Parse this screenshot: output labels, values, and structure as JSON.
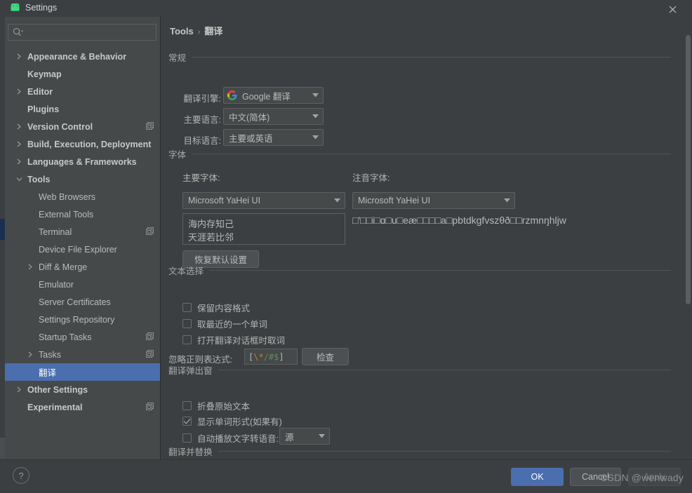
{
  "window": {
    "title": "Settings",
    "app_icon": "android-robot-icon",
    "close_icon": "close-icon"
  },
  "sidebar": {
    "search": {
      "placeholder": "",
      "value": "",
      "icon": "search-icon"
    },
    "items": [
      {
        "label": "Appearance & Behavior",
        "arrow": "chevron-right",
        "indent": 0,
        "bold": true,
        "selected": false,
        "copy": false
      },
      {
        "label": "Keymap",
        "arrow": "none",
        "indent": 0,
        "bold": true,
        "selected": false,
        "copy": false
      },
      {
        "label": "Editor",
        "arrow": "chevron-right",
        "indent": 0,
        "bold": true,
        "selected": false,
        "copy": false
      },
      {
        "label": "Plugins",
        "arrow": "none",
        "indent": 0,
        "bold": true,
        "selected": false,
        "copy": false
      },
      {
        "label": "Version Control",
        "arrow": "chevron-right",
        "indent": 0,
        "bold": true,
        "selected": false,
        "copy": true
      },
      {
        "label": "Build, Execution, Deployment",
        "arrow": "chevron-right",
        "indent": 0,
        "bold": true,
        "selected": false,
        "copy": false
      },
      {
        "label": "Languages & Frameworks",
        "arrow": "chevron-right",
        "indent": 0,
        "bold": true,
        "selected": false,
        "copy": false
      },
      {
        "label": "Tools",
        "arrow": "chevron-down",
        "indent": 0,
        "bold": true,
        "selected": false,
        "copy": false
      },
      {
        "label": "Web Browsers",
        "arrow": "none",
        "indent": 1,
        "bold": false,
        "selected": false,
        "copy": false
      },
      {
        "label": "External Tools",
        "arrow": "none",
        "indent": 1,
        "bold": false,
        "selected": false,
        "copy": false
      },
      {
        "label": "Terminal",
        "arrow": "none",
        "indent": 1,
        "bold": false,
        "selected": false,
        "copy": true
      },
      {
        "label": "Device File Explorer",
        "arrow": "none",
        "indent": 1,
        "bold": false,
        "selected": false,
        "copy": false
      },
      {
        "label": "Diff & Merge",
        "arrow": "chevron-right",
        "indent": 1,
        "bold": false,
        "selected": false,
        "copy": false
      },
      {
        "label": "Emulator",
        "arrow": "none",
        "indent": 1,
        "bold": false,
        "selected": false,
        "copy": false
      },
      {
        "label": "Server Certificates",
        "arrow": "none",
        "indent": 1,
        "bold": false,
        "selected": false,
        "copy": false
      },
      {
        "label": "Settings Repository",
        "arrow": "none",
        "indent": 1,
        "bold": false,
        "selected": false,
        "copy": false
      },
      {
        "label": "Startup Tasks",
        "arrow": "none",
        "indent": 1,
        "bold": false,
        "selected": false,
        "copy": true
      },
      {
        "label": "Tasks",
        "arrow": "chevron-right",
        "indent": 1,
        "bold": false,
        "selected": false,
        "copy": true
      },
      {
        "label": "翻译",
        "arrow": "none",
        "indent": 1,
        "bold": false,
        "selected": true,
        "copy": false
      },
      {
        "label": "Other Settings",
        "arrow": "chevron-right",
        "indent": 0,
        "bold": true,
        "selected": false,
        "copy": false
      },
      {
        "label": "Experimental",
        "arrow": "none",
        "indent": 0,
        "bold": true,
        "selected": false,
        "copy": true
      }
    ]
  },
  "main": {
    "breadcrumb": {
      "root": "Tools",
      "separator": "›",
      "leaf": "翻译"
    },
    "sections": {
      "general": {
        "title": "常规",
        "engine_label": "翻译引擎:",
        "engine_value": "Google 翻译",
        "engine_icon": "google-g-icon",
        "primary_lang_label": "主要语言:",
        "primary_lang_value": "中文(简体)",
        "target_lang_label": "目标语言:",
        "target_lang_value": "主要或英语"
      },
      "font": {
        "title": "字体",
        "primary_font_label": "主要字体:",
        "primary_font_value": "Microsoft YaHei UI",
        "phonetic_font_label": "注音字体:",
        "phonetic_font_value": "Microsoft YaHei UI",
        "primary_preview": "海内存知己\n天涯若比邻",
        "phonetic_preview": "□'□□i□ɑ□u□eæ□□□□a□pbtdkgfvszθð□□rzmnŋhljw",
        "reset_button": "恢复默认设置"
      },
      "text_selection": {
        "title": "文本选择",
        "checkboxes": [
          {
            "label": "保留内容格式",
            "checked": false
          },
          {
            "label": "取最近的一个单词",
            "checked": false
          },
          {
            "label": "打开翻译对话框时取词",
            "checked": false
          }
        ],
        "regex_label": "忽略正则表达式:",
        "regex_value": "[\\*/#$]",
        "check_button": "检查"
      },
      "popup": {
        "title": "翻译弹出窗",
        "checkboxes": [
          {
            "label": "折叠原始文本",
            "checked": false
          },
          {
            "label": "显示单词形式(如果有)",
            "checked": true
          },
          {
            "label": "自动播放文字转语音:",
            "checked": false
          }
        ],
        "tts_value": "源"
      },
      "replace": {
        "title": "翻译并替换"
      }
    }
  },
  "footer": {
    "help_label": "?",
    "ok_label": "OK",
    "cancel_label": "Cancel",
    "apply_label": "Apply",
    "watermark": "CSDN @wenwady"
  },
  "colors": {
    "accent": "#4b6eaf",
    "panel_bg": "#3c3f41",
    "sidebar_bg": "#45494a",
    "text": "#bbbbbb"
  }
}
